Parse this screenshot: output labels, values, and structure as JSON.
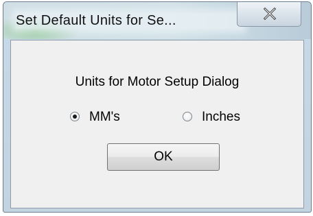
{
  "dialog": {
    "title": "Set Default Units for Se...",
    "prompt": "Units for Motor Setup Dialog",
    "options": [
      {
        "label": "MM's",
        "selected": true
      },
      {
        "label": "Inches",
        "selected": false
      }
    ],
    "ok_label": "OK"
  },
  "icons": {
    "close": "close-icon"
  },
  "colors": {
    "client_background": "#f0f0f0",
    "frame_tint": "#c3d3e0"
  }
}
